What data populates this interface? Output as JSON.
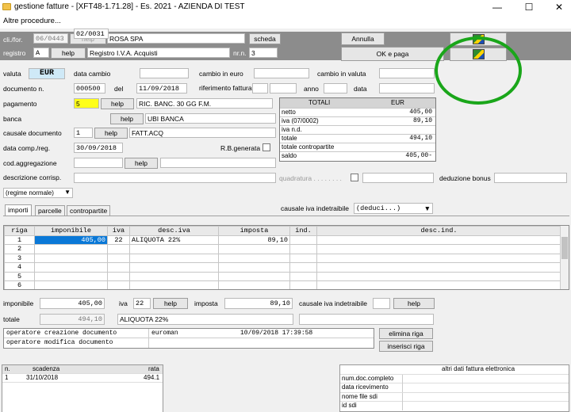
{
  "window": {
    "title": "gestione fatture - [XFT48-1.71.28] - Es. 2021 - AZIENDA DI TEST",
    "min": "—",
    "max": "☐",
    "close": "✕"
  },
  "menu": {
    "label": "Altre procedure..."
  },
  "header": {
    "cli_label": "cli./for.",
    "cli_code": "06/0443",
    "help1": "help",
    "cli_name": "ROSA SPA",
    "scheda": "scheda",
    "registro_label": "registro",
    "registro_code": "A",
    "help2": "help",
    "registro_name": "Registro I.V.A. Acquisti",
    "nr_label": "nr.n.",
    "nr_value": "3",
    "annulla": "Annulla",
    "ok": "OK e paga"
  },
  "fields": {
    "valuta_label": "valuta",
    "valuta": "EUR",
    "data_cambio_label": "data cambio",
    "cambio_euro_label": "cambio in euro",
    "cambio_valuta_label": "cambio in valuta",
    "documento_label": "documento n.",
    "documento": "000500",
    "del_label": "del",
    "data_doc": "11/09/2018",
    "rif_label": "riferimento fattura",
    "anno_label": "anno",
    "data_label": "data",
    "pagamento_label": "pagamento",
    "pagamento_code": "5",
    "help3": "help",
    "pagamento_desc": "RIC. BANC. 30 GG F.M.",
    "banca_label": "banca",
    "banca_code": "02/0031",
    "help4": "help",
    "banca_desc": "UBI BANCA",
    "causale_label": "causale documento",
    "causale_code": "1",
    "help5": "help",
    "causale_desc": "FATT.ACQ",
    "data_comp_label": "data comp./reg.",
    "data_comp": "30/09/2018",
    "rb_label": "R.B.generata",
    "cod_aggr_label": "cod.aggregazione",
    "help6": "help",
    "descr_label": "descrizione corrisp.",
    "quadratura_label": "quadratura . . . . . . . .",
    "deduzione_label": "deduzione bonus",
    "regime": "(regime normale)",
    "causale_iva_label": "causale iva indetraibile",
    "causale_iva_value": "(deduci...)"
  },
  "totali": {
    "header_left": "TOTALI",
    "header_right": "EUR",
    "rows": [
      {
        "label": "netto",
        "value": "405,00"
      },
      {
        "label": "iva (07/0002)",
        "value": "89,10"
      },
      {
        "label": "iva n.d.",
        "value": ""
      },
      {
        "label": "totale",
        "value": "494,10"
      },
      {
        "label": "totale contropartite",
        "value": ""
      },
      {
        "label": "saldo",
        "value": "405,00-"
      }
    ]
  },
  "tabs": [
    {
      "label": "importi"
    },
    {
      "label": "parcelle"
    },
    {
      "label": "contropartite"
    }
  ],
  "grid": {
    "headers": [
      "riga",
      "imponibile",
      "iva",
      "desc.iva",
      "imposta",
      "ind.",
      "desc.ind."
    ],
    "rows": [
      [
        "1",
        "405,00",
        "22",
        "ALIQUOTA 22%",
        "89,10",
        "",
        ""
      ],
      [
        "2",
        "",
        "",
        "",
        "",
        "",
        ""
      ],
      [
        "3",
        "",
        "",
        "",
        "",
        "",
        ""
      ],
      [
        "4",
        "",
        "",
        "",
        "",
        "",
        ""
      ],
      [
        "5",
        "",
        "",
        "",
        "",
        "",
        ""
      ],
      [
        "6",
        "",
        "",
        "",
        "",
        "",
        ""
      ]
    ]
  },
  "bottom": {
    "imponibile_label": "imponibile",
    "imponibile": "405,00",
    "iva_label": "iva",
    "iva": "22",
    "help7": "help",
    "imposta_label": "imposta",
    "imposta": "89,10",
    "caus_iva_label": "causale iva indetraibile",
    "help8": "help",
    "totale_label": "totale",
    "totale": "494,10",
    "aliquota": "ALIQUOTA 22%",
    "elimina": "elimina riga",
    "inserisci": "inserisci riga"
  },
  "operators": [
    {
      "label": "operatore creazione documento",
      "user": "euroman",
      "date": "10/09/2018 17:39:58"
    },
    {
      "label": "operatore modifica documento",
      "user": "",
      "date": ""
    }
  ],
  "scadenze": {
    "headers": [
      "n.",
      "scadenza",
      "rata"
    ],
    "rows": [
      [
        "1",
        "31/10/2018",
        "494.1"
      ]
    ]
  },
  "fattura_el": {
    "title": "altri dati fattura elettronica",
    "rows": [
      "num.doc.completo",
      "data ricevimento",
      "nome file sdi",
      "id sdi"
    ]
  }
}
